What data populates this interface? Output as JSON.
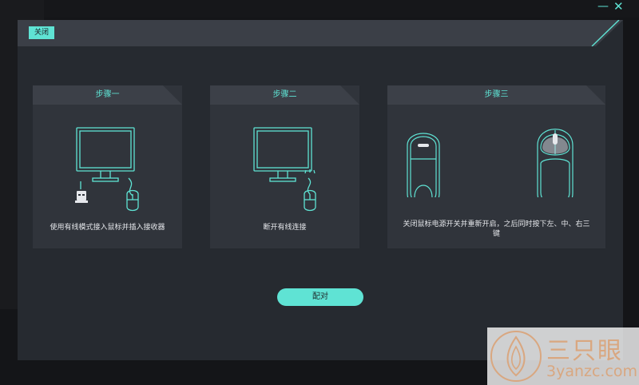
{
  "window": {
    "minimize_glyph": "—",
    "close_glyph": "✕"
  },
  "dialog": {
    "close_tab_label": "关闭",
    "pair_button_label": "配对"
  },
  "steps": [
    {
      "title": "步骤一",
      "description": "使用有线模式接入鼠标并插入接收器",
      "icon": "monitor-with-receiver-and-wired-mouse-icon"
    },
    {
      "title": "步骤二",
      "description": "断开有线连接",
      "icon": "monitor-with-disconnected-mouse-icon"
    },
    {
      "title": "步骤三",
      "description": "关闭鼠标电源开关并重新开启，之后同时按下左、中、右三键",
      "icon": "mouse-bottom-and-top-icon"
    }
  ],
  "watermark": {
    "chinese": "三只眼",
    "domain": "3yanzc.com"
  },
  "colors": {
    "accent": "#5fe3d4",
    "panel": "#262a30",
    "card": "#30343b",
    "watermark": "#d9a780"
  }
}
